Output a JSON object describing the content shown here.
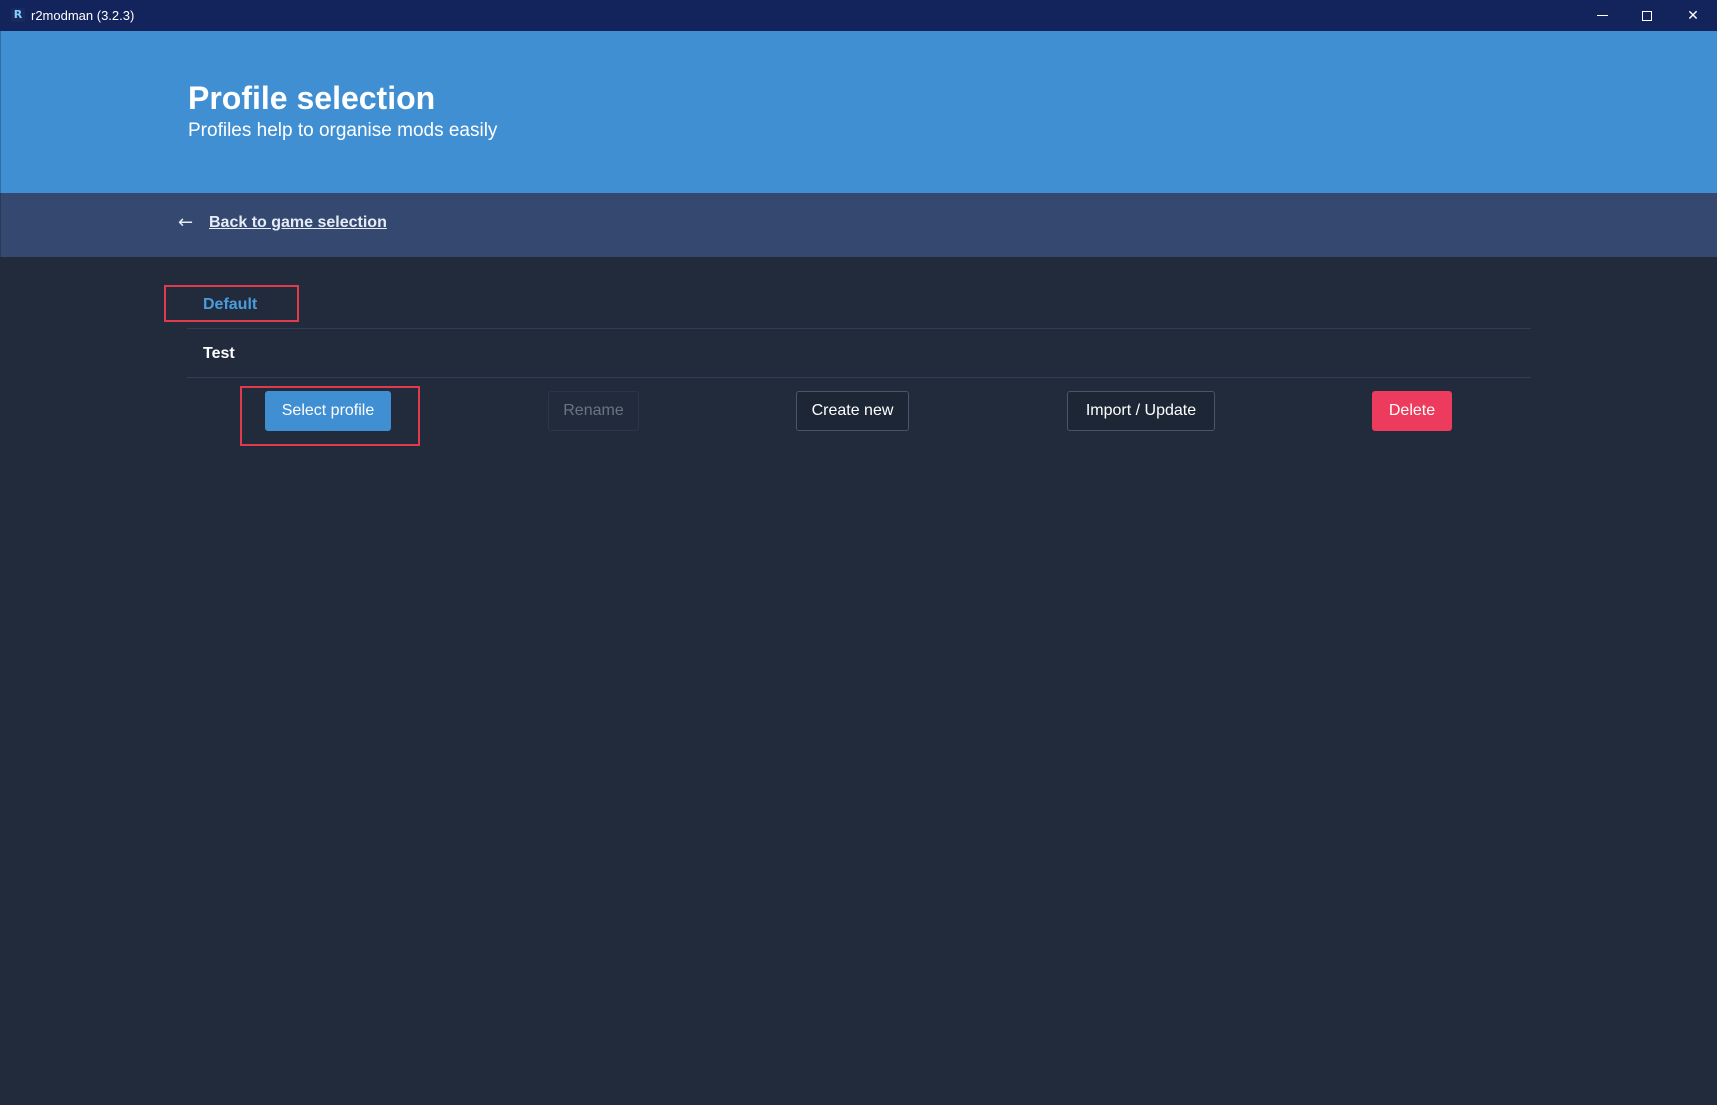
{
  "window": {
    "app_icon_letter": "R",
    "title": "r2modman (3.2.3)",
    "close_glyph": "✕"
  },
  "header": {
    "title": "Profile selection",
    "subtitle": "Profiles help to organise mods easily"
  },
  "nav": {
    "back_arrow": "←",
    "back_label": "Back to game selection"
  },
  "profiles": [
    {
      "name": "Default",
      "selected": true
    },
    {
      "name": "Test",
      "selected": false
    }
  ],
  "actions": {
    "select_label": "Select profile",
    "rename_label": "Rename",
    "create_label": "Create new",
    "import_label": "Import / Update",
    "delete_label": "Delete"
  },
  "colors": {
    "titlebar": "#13235c",
    "hero": "#408fd3",
    "navbar": "#354970",
    "background": "#212b3c",
    "accent": "#408fd3",
    "selected_text": "#4a9cdd",
    "danger": "#ec3b5c",
    "highlight_box": "#e03a4e"
  },
  "icons": {
    "app": "r2modman-logo-icon",
    "back": "arrow-left-icon",
    "minimize": "minimize-icon",
    "maximize": "maximize-icon",
    "close": "close-icon"
  }
}
